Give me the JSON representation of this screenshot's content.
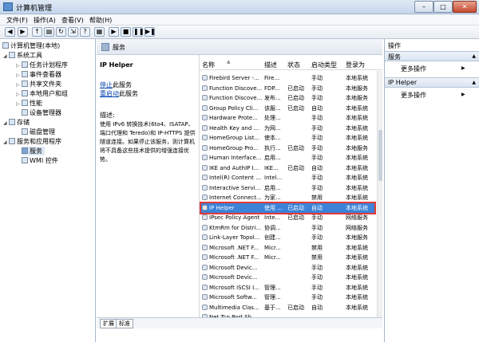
{
  "window": {
    "title": "计算机管理",
    "controls": {
      "minimize": "–",
      "maximize": "□",
      "close": "✕"
    }
  },
  "menu": [
    "文件(F)",
    "操作(A)",
    "查看(V)",
    "帮助(H)"
  ],
  "toolbar": {
    "icons": [
      "back-icon",
      "forward-icon",
      "up-folder-icon",
      "console-tree-icon",
      "refresh-icon",
      "export-icon",
      "help-icon",
      "properties-icon",
      "play-icon",
      "stop-icon",
      "pause-icon",
      "restart-icon"
    ]
  },
  "tree": [
    {
      "label": "计算机管理(本地)",
      "level": 0
    },
    {
      "label": "系统工具",
      "level": 1
    },
    {
      "label": "任务计划程序",
      "level": 2
    },
    {
      "label": "事件查看器",
      "level": 2
    },
    {
      "label": "共享文件夹",
      "level": 2
    },
    {
      "label": "本地用户和组",
      "level": 2
    },
    {
      "label": "性能",
      "level": 2
    },
    {
      "label": "设备管理器",
      "level": 2
    },
    {
      "label": "存储",
      "level": 1
    },
    {
      "label": "磁盘管理",
      "level": 2
    },
    {
      "label": "服务和应用程序",
      "level": 1
    },
    {
      "label": "服务",
      "level": 2
    },
    {
      "label": "WMI 控件",
      "level": 2
    }
  ],
  "content": {
    "header": "服务",
    "selected_service": "IP Helper",
    "stop_link": "停止",
    "stop_suffix": "此服务",
    "restart_link": "重启动",
    "restart_suffix": "此服务",
    "desc_label": "描述:",
    "description": "使用 IPv6 转换技术(6to4、ISATAP、端口代理和 Teredo)和 IP-HTTPS 提供隧道连接。如果停止该服务，则计算机将不具备这些技术提供的增强连接优势。",
    "columns": {
      "name": "名称",
      "desc": "描述",
      "status": "状态",
      "startup": "启动类型",
      "logon": "登录为"
    },
    "rows": [
      {
        "name": "Firebird Server -...",
        "desc": "Fire...",
        "status": "",
        "startup": "手动",
        "logon": "本地系统"
      },
      {
        "name": "Function Discove...",
        "desc": "FDP...",
        "status": "已启动",
        "startup": "手动",
        "logon": "本地服务"
      },
      {
        "name": "Function Discove...",
        "desc": "发布...",
        "status": "已启动",
        "startup": "手动",
        "logon": "本地服务"
      },
      {
        "name": "Group Policy Cli...",
        "desc": "该服...",
        "status": "已启动",
        "startup": "自动",
        "logon": "本地系统"
      },
      {
        "name": "Hardware Prote...",
        "desc": "处理...",
        "status": "",
        "startup": "手动",
        "logon": "本地系统"
      },
      {
        "name": "Health Key and ...",
        "desc": "为网...",
        "status": "",
        "startup": "手动",
        "logon": "本地系统"
      },
      {
        "name": "HomeGroup List...",
        "desc": "使本...",
        "status": "",
        "startup": "手动",
        "logon": "本地系统"
      },
      {
        "name": "HomeGroup Pro...",
        "desc": "执行...",
        "status": "已启动",
        "startup": "手动",
        "logon": "本地服务"
      },
      {
        "name": "Human Interface...",
        "desc": "启用...",
        "status": "",
        "startup": "手动",
        "logon": "本地系统"
      },
      {
        "name": "IKE and AuthIP I...",
        "desc": "IKE...",
        "status": "已启动",
        "startup": "自动",
        "logon": "本地系统"
      },
      {
        "name": "Intel(R) Content ...",
        "desc": "Intel...",
        "status": "",
        "startup": "手动",
        "logon": "本地系统"
      },
      {
        "name": "Interactive Servi...",
        "desc": "启用...",
        "status": "",
        "startup": "手动",
        "logon": "本地系统"
      },
      {
        "name": "Internet Connect...",
        "desc": "为家...",
        "status": "",
        "startup": "禁用",
        "logon": "本地系统"
      },
      {
        "name": "IP Helper",
        "desc": "使用 ...",
        "status": "已启动",
        "startup": "自动",
        "logon": "本地系统"
      },
      {
        "name": "IPsec Policy Agent",
        "desc": "Inte...",
        "status": "已启动",
        "startup": "手动",
        "logon": "网络服务"
      },
      {
        "name": "KtmRm for Distri...",
        "desc": "协调...",
        "status": "",
        "startup": "手动",
        "logon": "网络服务"
      },
      {
        "name": "Link-Layer Topol...",
        "desc": "创建...",
        "status": "",
        "startup": "手动",
        "logon": "本地服务"
      },
      {
        "name": "Microsoft .NET F...",
        "desc": "Micr...",
        "status": "",
        "startup": "禁用",
        "logon": "本地系统"
      },
      {
        "name": "Microsoft .NET F...",
        "desc": "Micr...",
        "status": "",
        "startup": "禁用",
        "logon": "本地系统"
      },
      {
        "name": "Microsoft Devic...",
        "desc": "",
        "status": "",
        "startup": "手动",
        "logon": "本地系统"
      },
      {
        "name": "Microsoft Devic...",
        "desc": "",
        "status": "",
        "startup": "手动",
        "logon": "本地系统"
      },
      {
        "name": "Microsoft iSCSI I...",
        "desc": "管理...",
        "status": "",
        "startup": "手动",
        "logon": "本地系统"
      },
      {
        "name": "Microsoft Softw...",
        "desc": "管理...",
        "status": "",
        "startup": "手动",
        "logon": "本地系统"
      },
      {
        "name": "Multimedia Clas...",
        "desc": "基于...",
        "status": "已启动",
        "startup": "自动",
        "logon": "本地系统"
      },
      {
        "name": "Net.Tcp Port Sh...",
        "desc": "",
        "status": "",
        "startup": "",
        "logon": ""
      }
    ],
    "selected_index": 13,
    "tabs": [
      "扩展",
      "标准"
    ]
  },
  "actions": {
    "title": "操作",
    "section1": "服务",
    "more1": "更多操作",
    "section2": "IP Helper",
    "more2": "更多操作"
  }
}
